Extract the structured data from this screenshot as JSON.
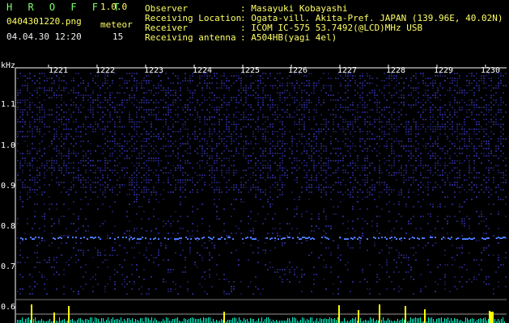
{
  "app": {
    "name": "H R O F F T",
    "version": "1.0.0"
  },
  "file": {
    "name": "0404301220.png",
    "datetime": "04.04.30 12:20"
  },
  "meteor": {
    "label": "meteor",
    "count": "15"
  },
  "info": [
    {
      "label": "Observer",
      "value": ": Masayuki Kobayashi"
    },
    {
      "label": "Receiving Location",
      "value": ": Ogata-vill. Akita-Pref. JAPAN (139.96E, 40.02N)"
    },
    {
      "label": "Receiver",
      "value": ": ICOM IC-575 53.7492(@LCD)MHz USB"
    },
    {
      "label": "Receiving antenna",
      "value": ": A504HB(yagi 4el)"
    }
  ],
  "axis": {
    "unit": "kHz",
    "time_ticks": [
      "1221",
      "1222",
      "1223",
      "1224",
      "1225",
      "1226",
      "1227",
      "1228",
      "1229",
      "1230"
    ],
    "freq_ticks": [
      "1.1",
      "1.0",
      "0.9",
      "0.8",
      "0.7",
      "0.6"
    ]
  },
  "colors": {
    "background": "#000000",
    "header_green": "#7cff6a",
    "header_yellow": "#ffff66",
    "noise_blue": "#23247a",
    "carrier_blue": "#4a7bff",
    "meteor_yellow": "#ffff00",
    "meteor_cyan": "#00ffd0"
  }
}
